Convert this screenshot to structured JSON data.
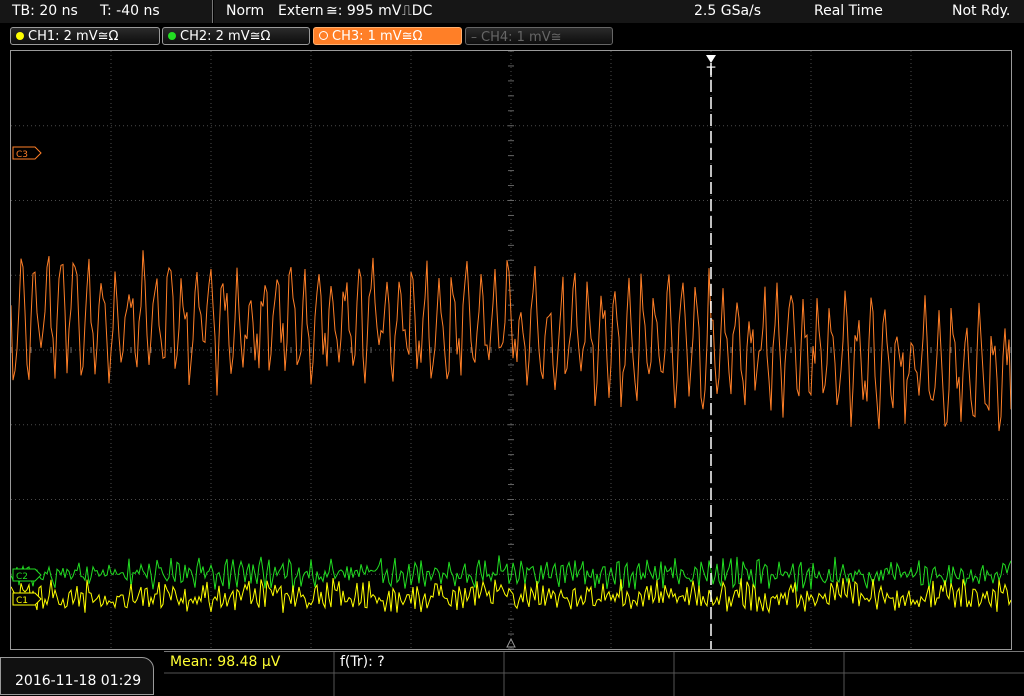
{
  "topbar": {
    "timebase": "TB: 20 ns",
    "trigger_pos": "T: -40 ns",
    "trigger_mode": "Norm",
    "trigger_source": "Extern",
    "trigger_level": "≅: 995 mV",
    "trigger_slope": "⎍DC",
    "sample_rate": "2.5 GSa/s",
    "acq_mode": "Real Time",
    "status": "Not Rdy."
  },
  "channels": [
    {
      "label": "CH1: 2 mV≅Ω",
      "color": "#ffff00",
      "active": true
    },
    {
      "label": "CH2: 2 mV≅Ω",
      "color": "#22dd22",
      "active": true
    },
    {
      "label": "CH3: 1 mV≅Ω",
      "color": "#ff7f27",
      "active": true,
      "selected": true
    },
    {
      "label": "CH4: 1 mV≅",
      "color": "#777777",
      "active": false
    }
  ],
  "markers": {
    "ch3_ref": "C3",
    "ch2_ref": "C2",
    "ch1_ref": "C1",
    "trigger": "T"
  },
  "bottombar": {
    "datetime": "2016-11-18 01:29",
    "measurement_mean": "Mean: 98.48 µV",
    "measurement_freq": "f(Tr): ?"
  },
  "colors": {
    "ch1": "#ffff00",
    "ch2": "#22dd22",
    "ch3": "#ff7f27",
    "grid": "#555555",
    "trigger_line": "#ffffff"
  }
}
